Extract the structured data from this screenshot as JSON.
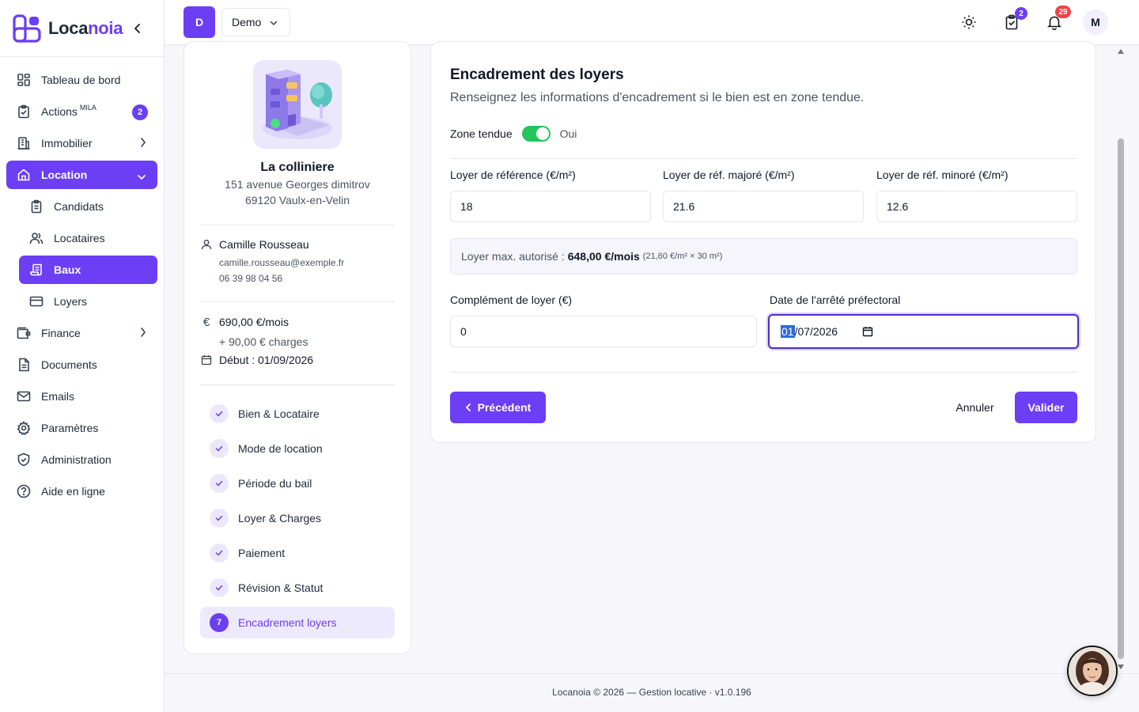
{
  "brand": {
    "name_part1": "Loca",
    "name_part2": "noia",
    "color": "#6c3ef4"
  },
  "sidebar": {
    "items": [
      {
        "label": "Tableau de bord",
        "icon": "dashboard-icon"
      },
      {
        "label": "Actions",
        "sup": "MILA",
        "icon": "clipboard-check-icon",
        "badge": "2"
      },
      {
        "label": "Immobilier",
        "icon": "building-icon"
      },
      {
        "label": "Location",
        "icon": "home-icon"
      },
      {
        "label": "Finance",
        "icon": "wallet-icon"
      },
      {
        "label": "Documents",
        "icon": "document-icon"
      },
      {
        "label": "Emails",
        "icon": "mail-icon"
      },
      {
        "label": "Paramètres",
        "icon": "gear-icon"
      },
      {
        "label": "Administration",
        "icon": "shield-icon"
      },
      {
        "label": "Aide en ligne",
        "icon": "help-icon"
      }
    ],
    "sub_items": [
      {
        "label": "Candidats",
        "icon": "clipboard-list-icon"
      },
      {
        "label": "Locataires",
        "icon": "users-icon"
      },
      {
        "label": "Baux",
        "icon": "scroll-icon"
      },
      {
        "label": "Loyers",
        "icon": "credit-card-icon"
      }
    ],
    "active_item": "Location",
    "active_sub_item": "Baux"
  },
  "topbar": {
    "workspace_initial": "D",
    "workspace_name": "Demo",
    "tasks_badge": "2",
    "notifications_badge": "29",
    "user_initial": "M"
  },
  "property": {
    "name": "La colliniere",
    "address_line1": "151 avenue Georges dimitrov",
    "address_line2": "69120 Vaulx-en-Velin",
    "tenant_name": "Camille Rousseau",
    "tenant_email": "camille.rousseau@exemple.fr",
    "tenant_phone": "06 39 98 04 56",
    "rent": "690,00 €/mois",
    "charges": "+ 90,00 € charges",
    "start_date": "Début : 01/09/2026"
  },
  "steps": [
    {
      "label": "Bien & Locataire",
      "done": true
    },
    {
      "label": "Mode de location",
      "done": true
    },
    {
      "label": "Période du bail",
      "done": true
    },
    {
      "label": "Loyer & Charges",
      "done": true
    },
    {
      "label": "Paiement",
      "done": true
    },
    {
      "label": "Révision & Statut",
      "done": true
    },
    {
      "label": "Encadrement loyers",
      "number": "7",
      "current": true
    }
  ],
  "form": {
    "title": "Encadrement des loyers",
    "subtitle": "Renseignez les informations d'encadrement si le bien est en zone tendue.",
    "zone_label": "Zone tendue",
    "zone_value": "Oui",
    "zone_enabled": true,
    "ref_label": "Loyer de référence (€/m²)",
    "ref_value": "18",
    "ref_major_label": "Loyer de réf. majoré (€/m²)",
    "ref_major_value": "21.6",
    "ref_minor_label": "Loyer de réf. minoré (€/m²)",
    "ref_minor_value": "12.6",
    "max_rent_label": "Loyer max. autorisé :",
    "max_rent_value": "648,00 €/mois",
    "max_rent_detail": "(21,60 €/m² × 30 m²)",
    "complement_label": "Complément de loyer (€)",
    "complement_value": "0",
    "date_label": "Date de l'arrêté préfectoral",
    "date_day": "01",
    "date_rest": "/07/2026",
    "prev_label": "Précédent",
    "cancel_label": "Annuler",
    "submit_label": "Valider"
  },
  "footer": {
    "text": "Locanoia © 2026 — Gestion locative · v1.0.196"
  }
}
